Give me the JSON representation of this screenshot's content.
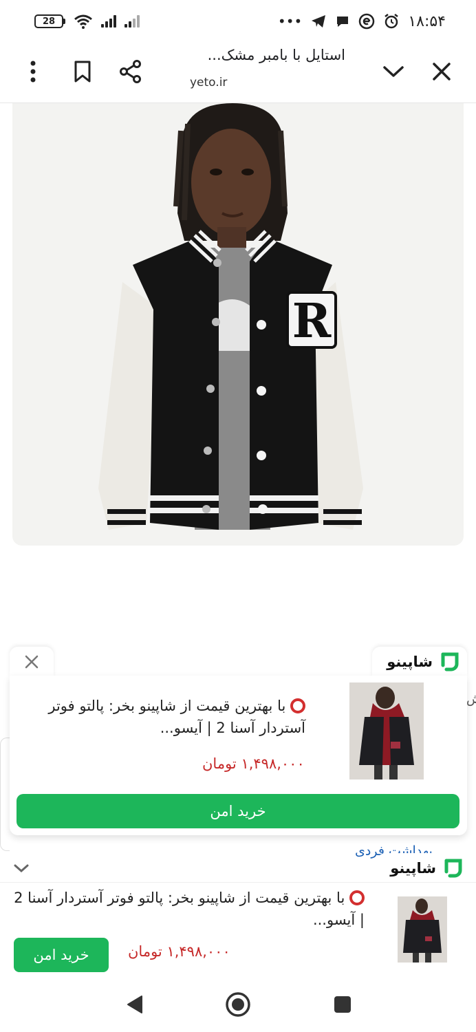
{
  "status_bar": {
    "battery": "28",
    "time": "۱۸:۵۴",
    "more": "•••"
  },
  "browser": {
    "title": "استایل با بامبر مشک...",
    "domain": "yeto.ir"
  },
  "article": {
    "image_alt": "varsity-jacket-photo",
    "patch_letter": "R"
  },
  "ad_card": {
    "brand": "شاپینو",
    "text": "با بهترین قیمت از شاپینو بخر: پالتو فوتر آستردار آسنا 2 | آیسو...",
    "price": "۱,۴۹۸,۰۰۰ تومان",
    "buy_label": "خرید امن"
  },
  "background": {
    "peek_text": "اش",
    "link_text": "بهداشت فردی"
  },
  "sticky_ad": {
    "brand": "شاپینو",
    "text": "با بهترین قیمت از شاپینو بخر: پالتو فوتر آستردار آسنا 2 | آیسو...",
    "price": "۱,۴۹۸,۰۰۰ تومان",
    "buy_label": "خرید امن"
  },
  "colors": {
    "accent_green": "#1db65a",
    "price_red": "#c62828",
    "link_blue": "#1a5fb4"
  }
}
